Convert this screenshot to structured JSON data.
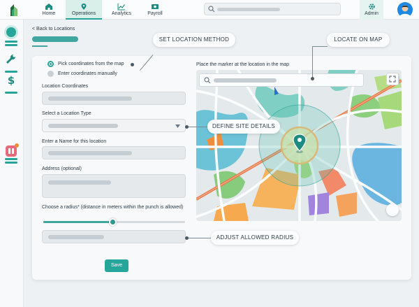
{
  "nav": {
    "tabs": [
      {
        "label": "Home",
        "icon": "home-icon"
      },
      {
        "label": "Operations",
        "icon": "location-pin-icon",
        "active": true
      },
      {
        "label": "Analytics",
        "icon": "chart-line-icon"
      },
      {
        "label": "Payroll",
        "icon": "money-icon"
      }
    ],
    "admin_label": "Admin"
  },
  "breadcrumb": {
    "back_label": "< Back to Locations"
  },
  "form": {
    "method_options": [
      {
        "label": "Pick coordinates from the map",
        "selected": true
      },
      {
        "label": "Enter coordinates manually",
        "selected": false
      }
    ],
    "coordinates_label": "Location Coordinates",
    "type_label": "Select a Location Type",
    "name_label": "Enter a Name for this location",
    "address_label": "Address (optional)",
    "radius_label": "Choose a radius* (distance in meters within the punch is allowed)",
    "radius_fraction": 0.49,
    "save_label": "Save"
  },
  "map": {
    "instruction": "Place the marker at the location in the map"
  },
  "callouts": {
    "set_method": "SET LOCATION METHOD",
    "locate_on_map": "LOCATE ON MAP",
    "define_details": "DEFINE SITE DETAILS",
    "adjust_radius": "ADJUST ALLOWED RADIUS"
  },
  "colors": {
    "accent": "#26a69a",
    "accent_dark": "#1f8a80",
    "field_bg": "#e6e9ec",
    "map_road": "#e87a4b",
    "map_green": "#7dc98e",
    "map_water": "#69b8e0",
    "map_orange": "#f5a25d",
    "map_purple": "#9e83d9"
  }
}
